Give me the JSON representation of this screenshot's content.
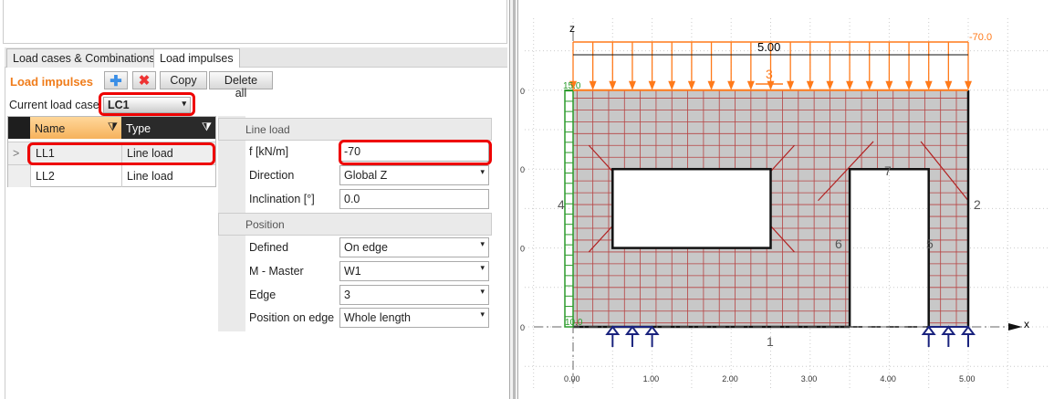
{
  "tabs": [
    "Load cases & Combinations",
    "Load impulses"
  ],
  "panel": {
    "title": "Load impulses",
    "add_icon": "plus-icon",
    "delete_icon": "x-icon",
    "copy": "Copy",
    "delete_all": "Delete all",
    "current_load_case_label": "Current load case",
    "current_load_case": "LC1"
  },
  "grid": {
    "headers": [
      "Name",
      "Type"
    ],
    "rows": [
      {
        "indicator": ">",
        "name": "LL1",
        "type": "Line load"
      },
      {
        "indicator": "",
        "name": "LL2",
        "type": "Line load"
      }
    ]
  },
  "props": {
    "section1": "Line load",
    "f_label": "f [kN/m]",
    "f_value": "-70",
    "direction_label": "Direction",
    "direction_value": "Global Z",
    "inclination_label": "Inclination [°]",
    "inclination_value": "0.0",
    "section2": "Position",
    "defined_label": "Defined",
    "defined_value": "On edge",
    "master_label": "M - Master",
    "master_value": "W1",
    "edge_label": "Edge",
    "edge_value": "3",
    "pos_label": "Position on edge",
    "pos_value": "Whole length"
  },
  "drawing": {
    "axis_z": "z",
    "axis_x": "x",
    "dimension": "5.00",
    "load_value": "-70.0",
    "edge_labels": [
      "1",
      "2",
      "3",
      "4",
      "5",
      "6",
      "7"
    ],
    "green_top": "15.0",
    "green_bottom": "10.0",
    "x_ticks": [
      "0.00",
      "1.00",
      "2.00",
      "3.00",
      "4.00",
      "5.00"
    ],
    "z_ticks": [
      "0",
      "0",
      "0",
      "0"
    ],
    "colors": {
      "load": "#ff7a1a",
      "support": "#1a237e",
      "mesh": "#b22222",
      "wall": "#c8c8c8",
      "green": "#2a9a2a"
    }
  }
}
